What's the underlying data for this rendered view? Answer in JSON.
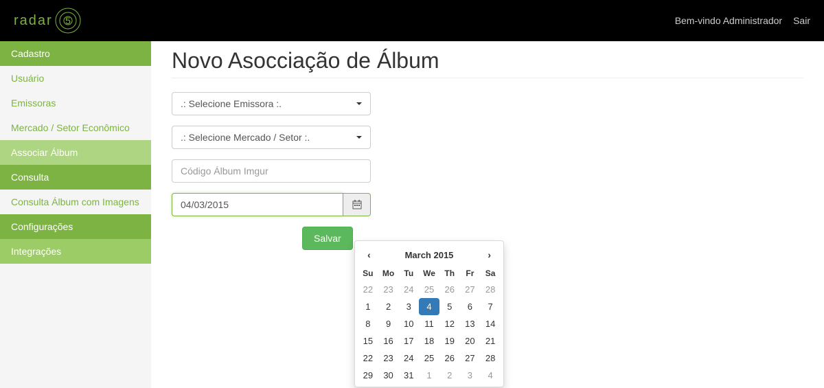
{
  "topbar": {
    "logo_text": "radar",
    "welcome": "Bem-vindo Administrador",
    "logout": "Sair"
  },
  "sidebar": {
    "sections": [
      {
        "header": "Cadastro",
        "header_class": "",
        "items": [
          {
            "label": "Usuário",
            "active": false
          },
          {
            "label": "Emissoras",
            "active": false
          },
          {
            "label": "Mercado / Setor Econômico",
            "active": false
          },
          {
            "label": "Associar Álbum",
            "active": true
          }
        ]
      },
      {
        "header": "Consulta",
        "header_class": "",
        "items": [
          {
            "label": "Consulta Álbum com Imagens",
            "active": false
          }
        ]
      },
      {
        "header": "Configurações",
        "header_class": "",
        "items": []
      },
      {
        "header": "Integrações",
        "header_class": "light",
        "items": []
      }
    ]
  },
  "main": {
    "title": "Novo Asocciação de Álbum",
    "emissora_placeholder": ".: Selecione Emissora :.",
    "mercado_placeholder": ".: Selecione Mercado / Setor :.",
    "codigo_placeholder": "Código Álbum Imgur",
    "date_value": "04/03/2015",
    "save_label": "Salvar"
  },
  "datepicker": {
    "title": "March 2015",
    "prev": "‹",
    "next": "›",
    "dow": [
      "Su",
      "Mo",
      "Tu",
      "We",
      "Th",
      "Fr",
      "Sa"
    ],
    "weeks": [
      [
        {
          "d": "22",
          "m": true
        },
        {
          "d": "23",
          "m": true
        },
        {
          "d": "24",
          "m": true
        },
        {
          "d": "25",
          "m": true
        },
        {
          "d": "26",
          "m": true
        },
        {
          "d": "27",
          "m": true
        },
        {
          "d": "28",
          "m": true
        }
      ],
      [
        {
          "d": "1"
        },
        {
          "d": "2"
        },
        {
          "d": "3"
        },
        {
          "d": "4",
          "a": true
        },
        {
          "d": "5"
        },
        {
          "d": "6"
        },
        {
          "d": "7"
        }
      ],
      [
        {
          "d": "8"
        },
        {
          "d": "9"
        },
        {
          "d": "10"
        },
        {
          "d": "11"
        },
        {
          "d": "12"
        },
        {
          "d": "13"
        },
        {
          "d": "14"
        }
      ],
      [
        {
          "d": "15"
        },
        {
          "d": "16"
        },
        {
          "d": "17"
        },
        {
          "d": "18"
        },
        {
          "d": "19"
        },
        {
          "d": "20"
        },
        {
          "d": "21"
        }
      ],
      [
        {
          "d": "22"
        },
        {
          "d": "23"
        },
        {
          "d": "24"
        },
        {
          "d": "25"
        },
        {
          "d": "26"
        },
        {
          "d": "27"
        },
        {
          "d": "28"
        }
      ],
      [
        {
          "d": "29"
        },
        {
          "d": "30"
        },
        {
          "d": "31"
        },
        {
          "d": "1",
          "m": true
        },
        {
          "d": "2",
          "m": true
        },
        {
          "d": "3",
          "m": true
        },
        {
          "d": "4",
          "m": true
        }
      ]
    ]
  }
}
